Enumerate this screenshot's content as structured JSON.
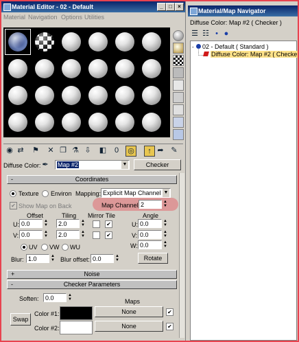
{
  "material_editor": {
    "title": "Material Editor - 02 - Default",
    "title_buttons": [
      "_",
      "□",
      "×"
    ],
    "menu": [
      "Material",
      "Navigation",
      "Options",
      "Utilities"
    ],
    "diffuse_label": "Diffuse Color:",
    "map_name": "Map #2",
    "map_type_button": "Checker",
    "coordinates": {
      "header": "Coordinates",
      "collapse_symbol": "-",
      "texture_label": "Texture",
      "environ_label": "Environ",
      "mapping_label": "Mapping:",
      "mapping_value": "Explicit Map Channel",
      "show_map_on_back": "Show Map on Back",
      "map_channel_label": "Map Channel:",
      "map_channel_value": "2",
      "offset_label": "Offset",
      "tiling_label": "Tiling",
      "mirror_tile_label": "Mirror Tile",
      "angle_label": "Angle",
      "u_label": "U:",
      "v_label": "V:",
      "w_label": "W:",
      "u_offset": "0.0",
      "v_offset": "0.0",
      "u_tiling": "2.0",
      "v_tiling": "2.0",
      "u_angle": "0.0",
      "v_angle": "0.0",
      "w_angle": "0.0",
      "uv_label": "UV",
      "vw_label": "VW",
      "wu_label": "WU",
      "blur_label": "Blur:",
      "blur_value": "1.0",
      "blur_offset_label": "Blur offset:",
      "blur_offset_value": "0.0",
      "rotate_button": "Rotate"
    },
    "noise": {
      "header": "Noise",
      "expand_symbol": "+"
    },
    "checker": {
      "header": "Checker Parameters",
      "collapse_symbol": "-",
      "soften_label": "Soften:",
      "soften_value": "0.0",
      "maps_label": "Maps",
      "swap_button": "Swap",
      "color1_label": "Color #1:",
      "color2_label": "Color #2:",
      "color1": "#000000",
      "color2": "#ffffff",
      "none1": "None",
      "none2": "None"
    }
  },
  "navigator": {
    "title": "Material/Map Navigator",
    "path": "Diffuse Color: Map #2  ( Checker )",
    "tree_root": "02 - Default  ( Standard )",
    "tree_child": "Diffuse Color: Map #2  ( Checker )"
  },
  "colors": {
    "title_bar": "#0a246a",
    "highlight": "#e8434f",
    "selected_item": "#ffe28a"
  }
}
